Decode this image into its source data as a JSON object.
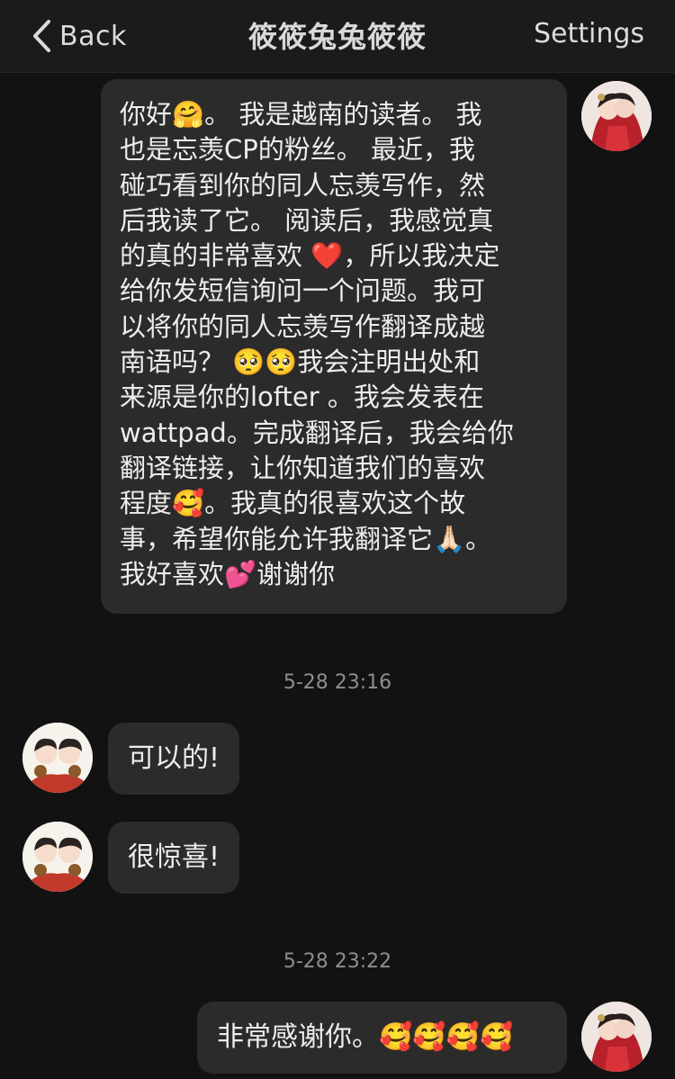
{
  "header": {
    "back_label": "Back",
    "title": "筱筱兔兔筱筱",
    "settings_label": "Settings"
  },
  "messages": [
    {
      "side": "right",
      "text": "你好🤗。我是越南的读者。我也是忘羡CP的粉丝。最近，我碰巧看到你的同人忘羡写作，然后我读了它。阅读后，我感觉真的真的非常喜欢❤️，所以我决定给你发短信询问一个问题。我可以将你的同人忘羡写作翻译成越南语吗？🥺🥺我会注明出处和来源是你的lofter。我会发表在wattpad。完成翻译后，我会给你翻译链接，让你知道我们的喜欢程度🥰。我真的很喜欢这个故事，希望你能允许我翻译它🙏🏻。我好喜欢💕谢谢你",
      "lines": [
        "你好🤗。 我是越南的读者。 我",
        "也是忘羡CP的粉丝。 最近，我",
        "碰巧看到你的同人忘羡写作，然",
        "后我读了它。 阅读后，我感觉真",
        "的真的非常喜欢 ❤️，所以我决定",
        "给你发短信询问一个问题。我可",
        "以将你的同人忘羡写作翻译成越",
        "南语吗？ 🥺🥺我会注明出处和",
        "来源是你的lofter 。我会发表在",
        "wattpad。完成翻译后，我会给你",
        "翻译链接，让你知道我们的喜欢",
        "程度🥰。我真的很喜欢这个故",
        "事，希望你能允许我翻译它🙏🏻。",
        "我好喜欢💕谢谢你"
      ]
    },
    {
      "side": "timestamp",
      "text": "5-28 23:16"
    },
    {
      "side": "left",
      "text": "可以的!"
    },
    {
      "side": "left",
      "text": "很惊喜!"
    },
    {
      "side": "timestamp",
      "text": "5-28 23:22"
    },
    {
      "side": "right",
      "text": "非常感谢你。🥰🥰🥰🥰"
    }
  ],
  "colors": {
    "background": "#121212",
    "header": "#1b1b1b",
    "bubble": "#2b2b2b",
    "text": "#ededed",
    "timestamp": "#8e8e8e"
  },
  "icons": {
    "back": "chevron-left-icon",
    "self_avatar": "avatar",
    "contact_avatar": "avatar"
  }
}
